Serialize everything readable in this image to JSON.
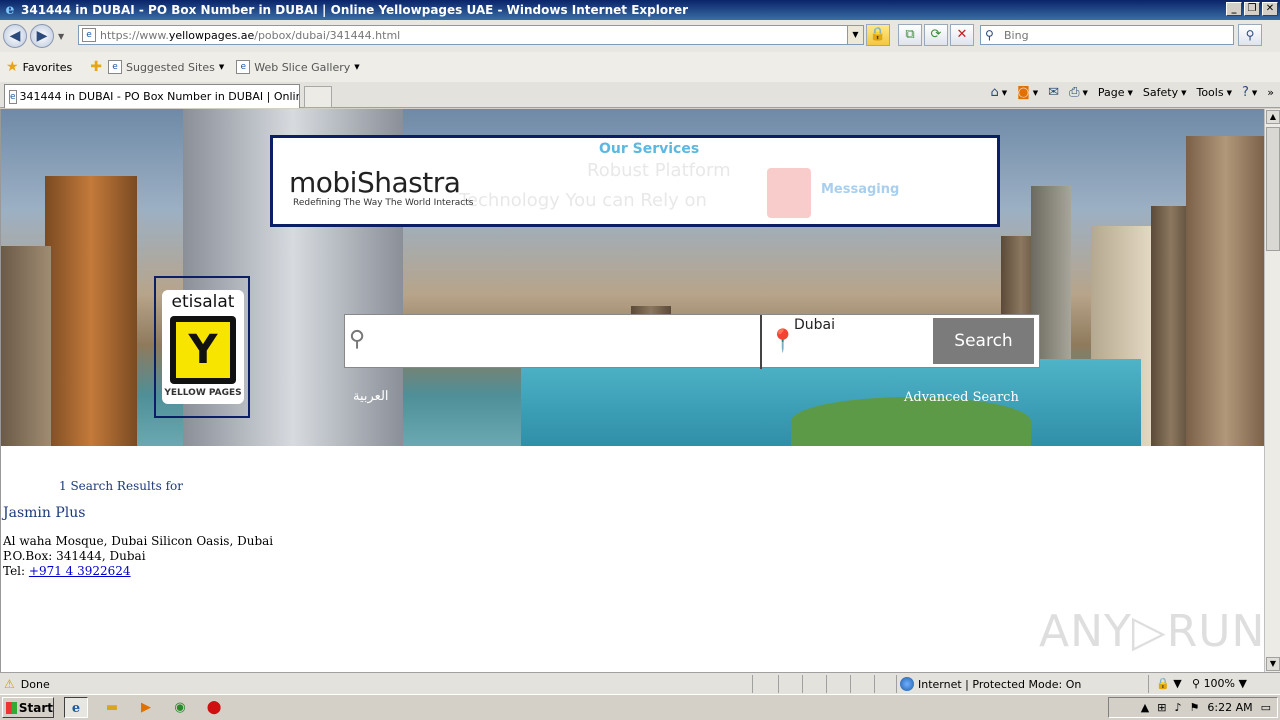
{
  "window": {
    "title": "341444 in DUBAI - PO Box Number in DUBAI | Online Yellowpages UAE - Windows Internet Explorer",
    "minimize": "_",
    "restore": "❐",
    "close": "✕"
  },
  "address_bar": {
    "url_prefix": "https://www.",
    "url_domain": "yellowpages.ae",
    "url_path": "/pobox/dubai/341444.html",
    "search_placeholder": "Bing"
  },
  "favorites_bar": {
    "favorites": "Favorites",
    "suggested_sites": "Suggested Sites",
    "web_slice_gallery": "Web Slice Gallery"
  },
  "tabs": [
    {
      "label": "341444 in DUBAI - PO Box Number in DUBAI | Online ..."
    }
  ],
  "command_bar": {
    "page": "Page",
    "safety": "Safety",
    "tools": "Tools"
  },
  "ad": {
    "services": "Our Services",
    "logo": "mobiShastra",
    "tagline": "Redefining The Way The World Interacts",
    "ghost_line1": "Robust Platform",
    "ghost_line2": "Technology You can Rely on",
    "messaging": "Messaging"
  },
  "brand_logo": {
    "brand": "etisalat",
    "product": "YELLOW PAGES"
  },
  "search": {
    "query_placeholder": "",
    "location": "Dubai",
    "button": "Search",
    "arabic_link": "العربية",
    "advanced": "Advanced Search"
  },
  "results": {
    "count_text": "1 Search Results for",
    "items": [
      {
        "name": "Jasmin Plus",
        "address": "Al waha Mosque, Dubai Silicon Oasis, Dubai",
        "pobox": "P.O.Box: 341444, Dubai",
        "tel_label": "Tel:",
        "tel": "+971 4 3922624"
      }
    ]
  },
  "watermark": "ANY▷RUN",
  "status_bar": {
    "status": "Done",
    "zone": "Internet | Protected Mode: On",
    "zoom": "100%"
  },
  "taskbar": {
    "start": "Start",
    "clock": "6:22 AM"
  }
}
